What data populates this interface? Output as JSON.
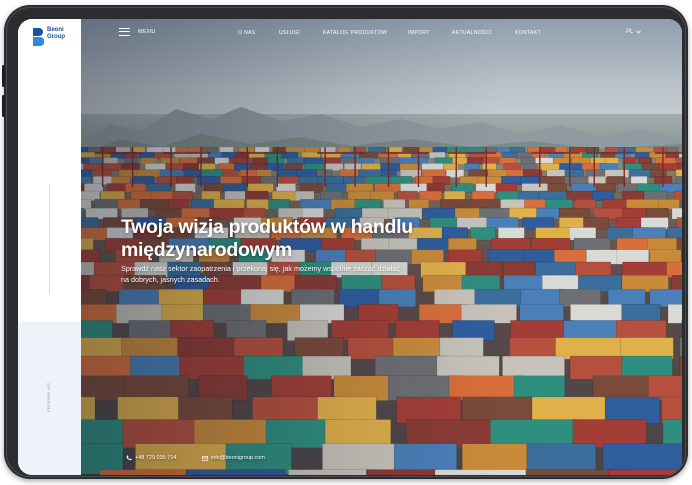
{
  "brand": {
    "name_line1": "Beoni",
    "name_line2": "Group",
    "accent_color": "#1e4fa3"
  },
  "nav": {
    "menu_label": "MENU",
    "links": [
      "O NAS",
      "USŁUGI",
      "KATALOG PRODUKTÓW",
      "IMPORT",
      "AKTUALNOŚCI",
      "KONTAKT"
    ],
    "language": "PL"
  },
  "side_label": "PRZEWIŃ NIŻ",
  "hero": {
    "title": "Twoja wizja produktów w handlu międzynarodowym",
    "subtitle": "Sprawdź nasz sektor zaopatrzenia i przekonaj się, jak możemy wspólnie zacząć działać - na dobrych, jasnych zasadach."
  },
  "contact": {
    "phone": "+48 729 035 714",
    "email": "info@beonigroup.com"
  },
  "icons": {
    "menu": "hamburger-icon",
    "language": "chevron-down-icon",
    "phone": "phone-icon",
    "email": "email-icon"
  }
}
